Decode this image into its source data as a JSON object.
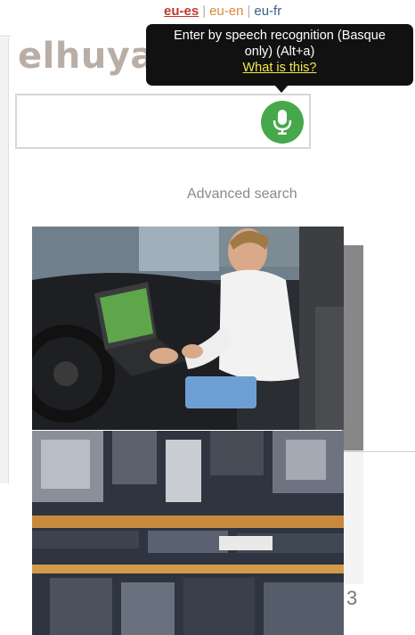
{
  "languages": {
    "items": [
      {
        "code": "eu-es",
        "active": true
      },
      {
        "code": "eu-en",
        "active": false
      },
      {
        "code": "eu-fr",
        "active": false
      }
    ]
  },
  "logo": {
    "text": "elhuyar"
  },
  "search": {
    "value": "",
    "placeholder": "",
    "mic_icon": "microphone-icon"
  },
  "tooltip": {
    "line1": "Enter by speech recognition (Basque",
    "line2": "only) (Alt+a)",
    "link": "What is this?"
  },
  "advanced_search": {
    "label": "Advanced search"
  },
  "carousel": {
    "page_number": "3",
    "images": [
      "man-with-laptop-in-car",
      "aerial-city-buildings"
    ]
  },
  "colors": {
    "mic_green": "#46a84b",
    "active_lang": "#c0392b",
    "tooltip_bg": "#111111",
    "tooltip_link": "#f5e94a"
  }
}
